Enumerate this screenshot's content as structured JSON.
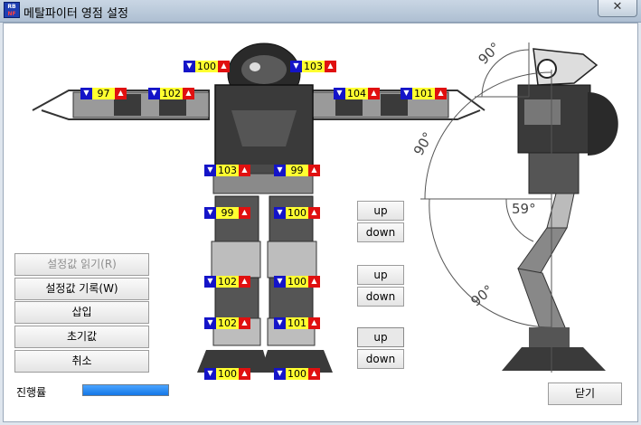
{
  "window": {
    "title": "메탈파이터 영점 설정",
    "close_glyph": "✕",
    "icon_text_top": "RB",
    "icon_text_bottom": "NF"
  },
  "servos": {
    "head_left": "100",
    "head_right": "103",
    "arm_left_outer": "97",
    "arm_left_inner": "102",
    "arm_right_inner": "104",
    "arm_right_outer": "101",
    "hip_left": "103",
    "hip_right": "99",
    "thigh_left": "99",
    "thigh_right": "100",
    "knee_left": "102",
    "knee_right": "100",
    "ankle_left": "102",
    "ankle_right": "101",
    "foot_left": "100",
    "foot_right": "100"
  },
  "angles": {
    "head": "90°",
    "torso": "90°",
    "knee": "59°",
    "leg": "90°"
  },
  "step_buttons": {
    "up1": "up",
    "down1": "down",
    "up2": "up",
    "down2": "down",
    "up3": "up",
    "down3": "down"
  },
  "actions": {
    "read": "설정값 읽기(R)",
    "write": "설정값 기록(W)",
    "insert": "삽입",
    "reset": "초기값",
    "cancel": "취소"
  },
  "progress": {
    "label": "진행률",
    "fraction": 1.0
  },
  "close_button": "닫기"
}
